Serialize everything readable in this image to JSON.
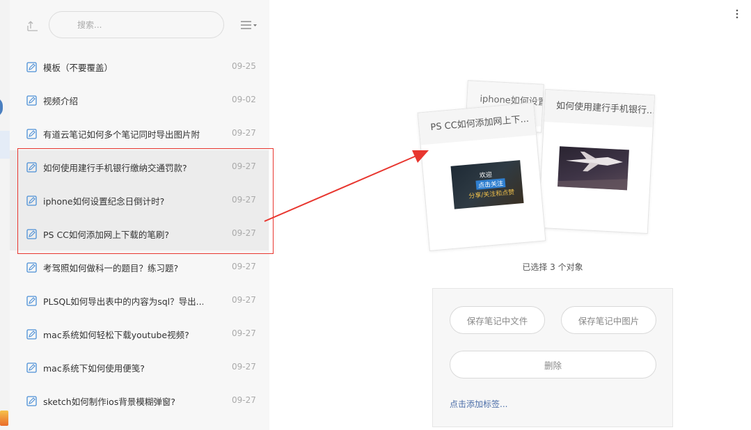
{
  "search": {
    "placeholder": "搜索..."
  },
  "notes": [
    {
      "title": "模板（不要覆盖）",
      "date": "09-25"
    },
    {
      "title": "视频介绍",
      "date": "09-02"
    },
    {
      "title": "有道云笔记如何多个笔记同时导出图片附",
      "date": "09-27"
    },
    {
      "title": "如何使用建行手机银行缴纳交通罚款?",
      "date": "09-27"
    },
    {
      "title": "iphone如何设置纪念日倒计时?",
      "date": "09-27"
    },
    {
      "title": "PS CC如何添加网上下载的笔刷?",
      "date": "09-27"
    },
    {
      "title": "考驾照如何做科一的题目？练习题?",
      "date": "09-27"
    },
    {
      "title": "PLSQL如何导出表中的内容为sql？导出...",
      "date": "09-27"
    },
    {
      "title": "mac系统如何轻松下载youtube视频?",
      "date": "09-27"
    },
    {
      "title": "mac系统下如何使用便笺?",
      "date": "09-27"
    },
    {
      "title": "sketch如何制作ios背景模糊弹窗?",
      "date": "09-27"
    }
  ],
  "preview": {
    "card_back_title": "iphone如何设置...",
    "card_right_title": "如何使用建行手机银行...",
    "card_left_title": "PS CC如何添加网上下...",
    "ps_thumb_line1": "欢迎",
    "ps_thumb_line2": "点击关注",
    "ps_thumb_line3": "分享/关注和点赞"
  },
  "selection": {
    "count_text": "已选择 3 个对象"
  },
  "actions": {
    "save_file": "保存笔记中文件",
    "save_image": "保存笔记中图片",
    "delete": "删除",
    "add_tag": "点击添加标签..."
  },
  "colors": {
    "highlight": "#e8362f",
    "accent": "#4b8fd6"
  }
}
